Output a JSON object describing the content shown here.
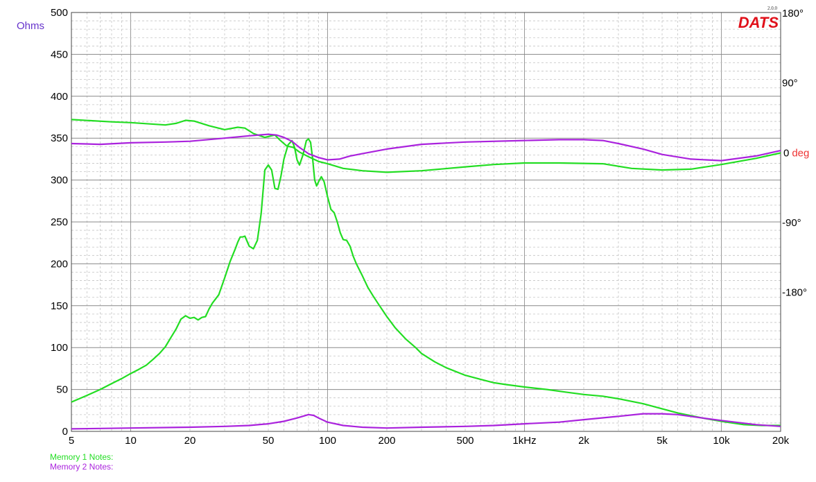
{
  "chart_data": {
    "type": "line",
    "x_scale": "log",
    "xlim": [
      5,
      20000
    ],
    "x_ticks": [
      {
        "value": 5,
        "label": "5"
      },
      {
        "value": 10,
        "label": "10"
      },
      {
        "value": 20,
        "label": "20"
      },
      {
        "value": 50,
        "label": "50"
      },
      {
        "value": 100,
        "label": "100"
      },
      {
        "value": 200,
        "label": "200"
      },
      {
        "value": 500,
        "label": "500"
      },
      {
        "value": 1000,
        "label": "1kHz"
      },
      {
        "value": 2000,
        "label": "2k"
      },
      {
        "value": 5000,
        "label": "5k"
      },
      {
        "value": 10000,
        "label": "10k"
      },
      {
        "value": 20000,
        "label": "20k"
      }
    ],
    "ylim": [
      0,
      500
    ],
    "y_ticks": [
      0,
      50,
      100,
      150,
      200,
      250,
      300,
      350,
      400,
      450,
      500
    ],
    "ylabel": "Ohms",
    "y2lim": [
      -360,
      180
    ],
    "y2_ticks": [
      {
        "value": 180,
        "label": "180°"
      },
      {
        "value": 90,
        "label": "90°"
      },
      {
        "value": 0,
        "label": "0",
        "unit": "deg"
      },
      {
        "value": -90,
        "label": "-90°"
      },
      {
        "value": -180,
        "label": "-180°"
      }
    ],
    "grid": true,
    "logo": {
      "text": "DATS",
      "version": "2.0.0",
      "color": "#e0101a"
    },
    "colors": {
      "memory1": "#22dd22",
      "memory2": "#aa22dd",
      "ylabel": "#6633cc",
      "deg": "#ee3333"
    },
    "series": [
      {
        "name": "Memory 1",
        "kind": "impedance",
        "axis": "left",
        "color": "#22dd22",
        "x": [
          5,
          6,
          7,
          8,
          9,
          10,
          11,
          12,
          13,
          14,
          15,
          16,
          17,
          18,
          19,
          20,
          21,
          22,
          23,
          24,
          25,
          26,
          28,
          30,
          32,
          34,
          35,
          36,
          37,
          38,
          40,
          42,
          44,
          46,
          48,
          50,
          52,
          54,
          56,
          58,
          60,
          63,
          66,
          68,
          70,
          72,
          75,
          78,
          80,
          82,
          84,
          86,
          88,
          90,
          93,
          96,
          100,
          104,
          108,
          112,
          116,
          120,
          125,
          130,
          135,
          140,
          150,
          160,
          170,
          180,
          200,
          220,
          250,
          280,
          300,
          350,
          400,
          500,
          600,
          700,
          800,
          1000,
          1300,
          1600,
          2000,
          2500,
          3000,
          4000,
          5000,
          6000,
          8000,
          10000,
          13000,
          16000,
          18000,
          20000
        ],
        "values": [
          35,
          43,
          50,
          57,
          63,
          69,
          74,
          79,
          86,
          93,
          101,
          112,
          122,
          134,
          138,
          135,
          136,
          133,
          136,
          137,
          146,
          153,
          163,
          183,
          203,
          218,
          226,
          232,
          232,
          233,
          221,
          218,
          228,
          260,
          312,
          318,
          312,
          290,
          289,
          305,
          325,
          342,
          347,
          339,
          324,
          318,
          330,
          347,
          349,
          345,
          325,
          300,
          293,
          298,
          304,
          298,
          280,
          265,
          261,
          250,
          237,
          229,
          228,
          221,
          209,
          200,
          186,
          172,
          162,
          153,
          137,
          124,
          110,
          100,
          93,
          83,
          76,
          67,
          62,
          58,
          56,
          53,
          50,
          47,
          44,
          42,
          39,
          33,
          27,
          22,
          16,
          12,
          8,
          7,
          7,
          7
        ]
      },
      {
        "name": "Memory 1",
        "kind": "phase",
        "axis": "right",
        "color": "#22dd22",
        "x": [
          5,
          8,
          10,
          15,
          17,
          19,
          21,
          25,
          30,
          35,
          38,
          42,
          48,
          54,
          57,
          62,
          67,
          72,
          80,
          90,
          100,
          120,
          150,
          200,
          300,
          500,
          700,
          1000,
          1500,
          2500,
          3500,
          5000,
          7000,
          10000,
          15000,
          20000
        ],
        "values": [
          42,
          39,
          38,
          35,
          37,
          41,
          40,
          34,
          29,
          32,
          31,
          24,
          19,
          22,
          16,
          8,
          6,
          0,
          -6,
          -12,
          -15,
          -21,
          -24,
          -26,
          -24,
          -19,
          -16,
          -14,
          -14,
          -15,
          -21,
          -23,
          -22,
          -16,
          -8,
          -1
        ]
      },
      {
        "name": "Memory 2",
        "kind": "impedance",
        "axis": "left",
        "color": "#aa22dd",
        "x": [
          5,
          10,
          20,
          30,
          40,
          50,
          60,
          70,
          80,
          85,
          90,
          100,
          120,
          150,
          200,
          300,
          500,
          700,
          1000,
          1500,
          2000,
          3000,
          4000,
          5000,
          6000,
          8000,
          10000,
          15000,
          20000
        ],
        "values": [
          3,
          4,
          5,
          6,
          7,
          9,
          12,
          16,
          20,
          19,
          16,
          11,
          7,
          5,
          4,
          5,
          6,
          7,
          9,
          11,
          14,
          18,
          21,
          21,
          20,
          16,
          13,
          8,
          6
        ]
      },
      {
        "name": "Memory 2",
        "kind": "phase",
        "axis": "right",
        "color": "#aa22dd",
        "x": [
          5,
          7,
          10,
          15,
          20,
          30,
          40,
          50,
          55,
          60,
          66,
          72,
          80,
          90,
          100,
          115,
          130,
          150,
          200,
          300,
          500,
          1000,
          1500,
          2000,
          2500,
          3000,
          4000,
          5000,
          7000,
          10000,
          15000,
          20000
        ],
        "values": [
          11,
          10,
          12,
          13,
          14,
          18,
          21,
          23,
          22,
          19,
          14,
          6,
          -2,
          -7,
          -10,
          -9,
          -5,
          -2,
          4,
          10,
          13,
          15,
          16,
          16,
          15,
          11,
          4,
          -3,
          -9,
          -11,
          -5,
          2
        ]
      }
    ]
  },
  "notes": {
    "memory1": "Memory 1 Notes:",
    "memory2": "Memory 2 Notes:"
  }
}
